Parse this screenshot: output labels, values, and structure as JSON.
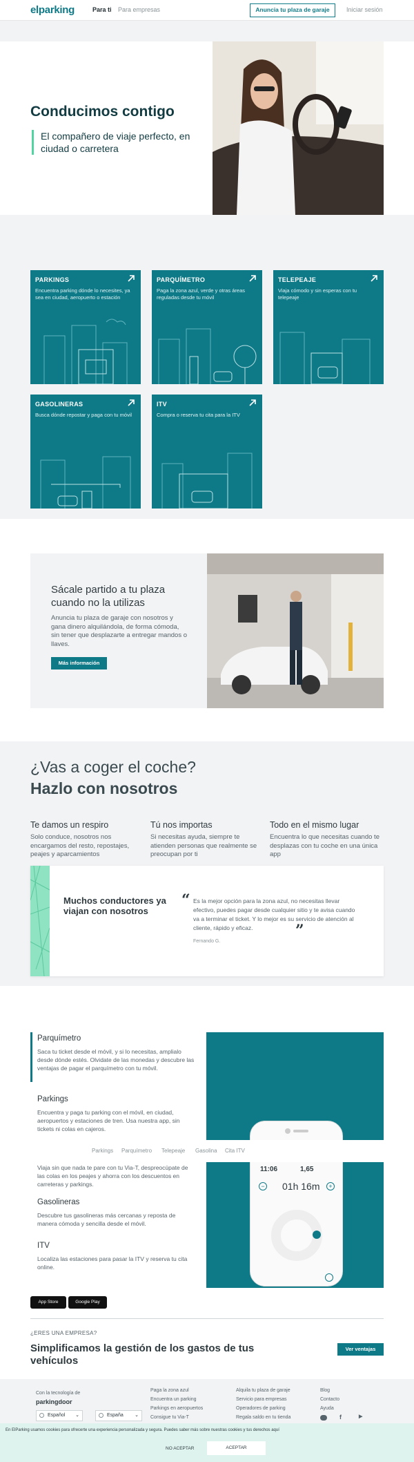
{
  "header": {
    "logo": "elparking",
    "nav": [
      "Para ti",
      "Para empresas"
    ],
    "cta": "Anuncia tu plaza de garaje",
    "login": "Iniciar sesión"
  },
  "hero": {
    "title": "Conducimos contigo",
    "subtitle": "El compañero de viaje perfecto, en ciudad o carretera"
  },
  "services": [
    {
      "title": "PARKINGS",
      "desc": "Encuentra parking dónde lo necesites, ya sea en ciudad, aeropuerto o estación"
    },
    {
      "title": "PARQUÍMETRO",
      "desc": "Paga la zona azul, verde y otras áreas reguladas desde tu móvil"
    },
    {
      "title": "TELEPEAJE",
      "desc": "Viaja cómodo y sin esperas con tu telepeaje"
    },
    {
      "title": "GASOLINERAS",
      "desc": "Busca dónde repostar y paga con tu móvil"
    },
    {
      "title": "ITV",
      "desc": "Compra o reserva tu cita para la ITV"
    }
  ],
  "partido": {
    "title": "Sácale partido a tu plaza cuando no la utilizas",
    "desc": "Anuncia tu plaza de garaje con nosotros y gana dinero alquilándola, de forma cómoda, sin tener que desplazarte a entregar mandos o llaves.",
    "button": "Más información"
  },
  "coger": {
    "title1": "¿Vas a coger el coche?",
    "title2": "Hazlo con nosotros",
    "columns": [
      {
        "title": "Te damos un respiro",
        "desc": "Solo conduce, nosotros nos encargamos del resto, repostajes, peajes y aparcamientos"
      },
      {
        "title": "Tú nos importas",
        "desc": "Si necesitas ayuda, siempre te atienden personas que realmente se preocupan por ti"
      },
      {
        "title": "Todo en el mismo lugar",
        "desc": "Encuentra lo que necesitas cuando te desplazas con tu coche en una única app"
      }
    ]
  },
  "testimonial": {
    "title": "Muchos conductores ya viajan con nosotros",
    "quote": "Es la mejor opción para la zona azul, no necesitas llevar efectivo, puedes pagar desde cualquier sitio y te avisa cuando va a terminar el ticket. Y lo mejor es su servicio de atención al cliente, rápido y eficaz.",
    "author": "Fernando G."
  },
  "features": {
    "items": [
      {
        "title": "Parquímetro",
        "desc": "Saca tu ticket desde el móvil, y si lo necesitas, amplialo desde dónde estés. Olvidate de las monedas y descubre las ventajas de pagar el parquímetro con tu móvil."
      },
      {
        "title": "Parkings",
        "desc": "Encuentra y paga tu parking con el móvil, en ciudad, aeropuertos y estaciones de tren. Usa nuestra app, sin tickets ni colas en cajeros."
      },
      {
        "title": "",
        "desc": "Viaja sin que nada te pare con tu Via-T, despreocúpate de las colas en los peajes y ahorra con los descuentos en carreteras y parkings."
      },
      {
        "title": "Gasolineras",
        "desc": "Descubre tus gasolineras más cercanas y reposta de manera cómoda y sencilla desde el móvil."
      },
      {
        "title": "ITV",
        "desc": "Localiza las estaciones para pasar la ITV y reserva tu cita online."
      }
    ],
    "floatbar": [
      "Parkings",
      "Parquímetro",
      "Telepeaje",
      "Gasolina",
      "Cita ITV"
    ],
    "phone": {
      "time1": "11:06",
      "price": "1,65",
      "duration": "01h 16m"
    },
    "stores": [
      "App Store",
      "Google Play"
    ]
  },
  "empresa": {
    "question": "¿ERES UNA EMPRESA?",
    "title": "Simplificamos la gestión de los gastos de tus vehículos",
    "button": "Ver ventajas"
  },
  "footer": {
    "tech_label": "Con la tecnología de",
    "tech_brand": "parkingdoor",
    "lang": "Español",
    "country": "España",
    "col1": [
      "Paga la zona azul",
      "Encuentra un parking",
      "Parkings en aeropuertos",
      "Consigue tu Via-T"
    ],
    "col2": [
      "Alquila tu plaza de garaje",
      "Servicio para empresas",
      "Operadores de parking",
      "Regala saldo en tu tienda"
    ],
    "col3": [
      "Blog",
      "Contacto",
      "Ayuda"
    ]
  },
  "cookie": {
    "text": "En ElParking usamos cookies para ofrecerte una experiencia personalizada y segura. Puedes saber más sobre nuestras cookies y tus derechos aquí",
    "reject": "NO ACEPTAR",
    "accept": "ACEPTAR"
  },
  "colors": {
    "brand": "#0e7a87",
    "accent": "#51d4a0",
    "mint": "#8fe3c2"
  }
}
